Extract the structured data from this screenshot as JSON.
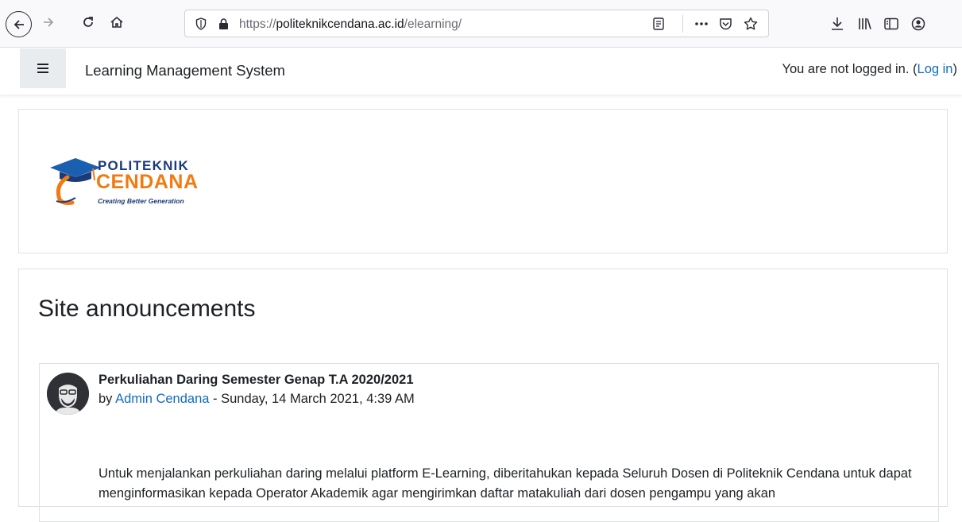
{
  "browser": {
    "url_scheme": "https://",
    "url_host": "politeknikcendana.ac.id",
    "url_path": "/elearning/",
    "icons": [
      "back-icon",
      "forward-icon",
      "reload-icon",
      "home-icon",
      "shield-icon",
      "lock-icon",
      "reader-view-icon",
      "more-icon",
      "pocket-icon",
      "bookmark-star-icon",
      "download-icon",
      "library-icon",
      "sidebar-icon",
      "account-icon"
    ]
  },
  "navbar": {
    "site_name": "Learning Management System",
    "login_text": "You are not logged in. (",
    "login_link": "Log in",
    "login_close": ")"
  },
  "logo": {
    "word1": "POLITEKNIK",
    "word2": "CENDANA",
    "tagline": "Creating Better Generation",
    "colors": {
      "blue": "#1b3a7a",
      "orange": "#f07b12"
    }
  },
  "announcements": {
    "title": "Site announcements",
    "post": {
      "subject": "Perkuliahan Daring Semester Genap T.A 2020/2021",
      "by": "by ",
      "author": "Admin Cendana",
      "date": " - Sunday, 14 March 2021, 4:39 AM",
      "body": "Untuk menjalankan perkuliahan daring melalui platform E-Learning, diberitahukan kepada Seluruh Dosen di Politeknik Cendana untuk dapat menginformasikan kepada Operator Akademik agar mengirimkan daftar matakuliah dari dosen pengampu yang akan"
    }
  },
  "colors": {
    "link": "#0f6cbf",
    "text": "#1d2125",
    "border": "#dee2e6"
  }
}
